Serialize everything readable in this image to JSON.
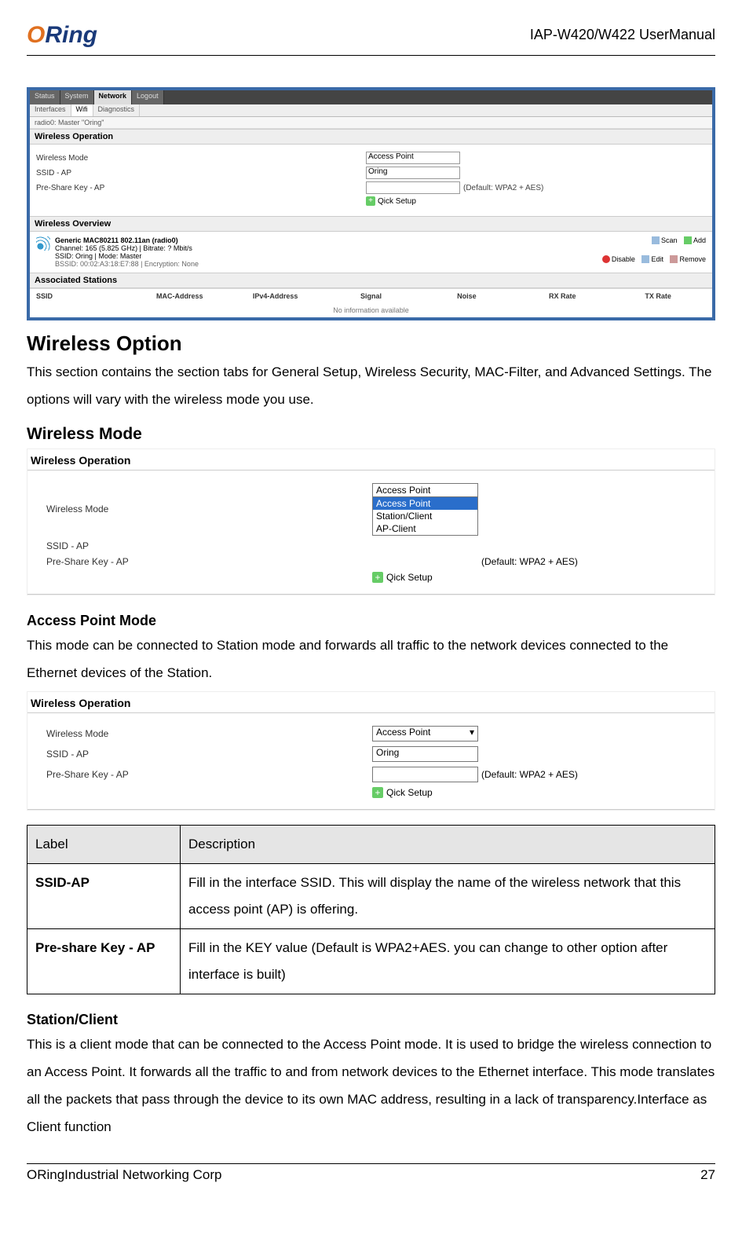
{
  "header": {
    "logo_1": "O",
    "logo_2": "Ring",
    "doc": "IAP-W420/W422  UserManual"
  },
  "ss1": {
    "tabs": [
      "Status",
      "System",
      "Network",
      "Logout"
    ],
    "subtabs": [
      "Interfaces",
      "Wifi",
      "Diagnostics"
    ],
    "crumb": "radio0: Master \"Oring\"",
    "sec_op": "Wireless Operation",
    "lbl_mode": "Wireless Mode",
    "sel_mode": "Access Point",
    "lbl_ssid": "SSID - AP",
    "val_ssid": "Oring",
    "lbl_psk": "Pre-Share Key - AP",
    "hint_psk": "(Default: WPA2 + AES)",
    "quick": "Qick Setup",
    "sec_ov": "Wireless Overview",
    "ov_l1": "Generic MAC80211 802.11an (radio0)",
    "ov_l2": "Channel: 165 (5.825 GHz) | Bitrate: ? Mbit/s",
    "ov_l3a": "SSID: Oring | Mode: Master",
    "ov_l3b": "BSSID: 00:02:A3:18:E7:88 | Encryption: None",
    "act_scan": "Scan",
    "act_add": "Add",
    "act_dis": "Disable",
    "act_edit": "Edit",
    "act_rem": "Remove",
    "sec_as": "Associated Stations",
    "cols": [
      "SSID",
      "MAC-Address",
      "IPv4-Address",
      "Signal",
      "Noise",
      "RX Rate",
      "TX Rate"
    ],
    "no_info": "No information available"
  },
  "h_wireless_option": "Wireless Option",
  "p_wireless_option": "This section contains the section tabs for General Setup, Wireless Security, MAC-Filter, and Advanced Settings. The options will vary with the wireless mode you use.",
  "h_wireless_mode": "Wireless Mode",
  "ss2": {
    "title": "Wireless Operation",
    "lbl_mode": "Wireless Mode",
    "sel_mode": "Access Point",
    "opts": [
      "Access Point",
      "Station/Client",
      "AP-Client"
    ],
    "lbl_ssid": "SSID - AP",
    "lbl_psk": "Pre-Share Key - AP",
    "hint_psk": "(Default: WPA2 + AES)",
    "quick": "Qick Setup"
  },
  "h_ap": "Access Point Mode",
  "p_ap": "This mode can be connected to Station mode and forwards all traffic to the network devices connected to the Ethernet devices of the Station.",
  "ss3": {
    "title": "Wireless Operation",
    "lbl_mode": "Wireless Mode",
    "sel_mode": "Access Point",
    "lbl_ssid": "SSID - AP",
    "val_ssid": "Oring",
    "lbl_psk": "Pre-Share Key - AP",
    "hint_psk": "(Default: WPA2 + AES)",
    "quick": "Qick Setup"
  },
  "table": {
    "h1": "Label",
    "h2": "Description",
    "r1l": "SSID-AP",
    "r1d": "Fill in the interface SSID. This will display the name of the wireless network that this access point (AP) is offering.",
    "r2l": "Pre-share Key - AP",
    "r2d": "Fill in the KEY value (Default is WPA2+AES. you can change to other option after interface is built)"
  },
  "h_station": "Station/Client",
  "p_station": "This is a client mode that can be connected to the Access Point mode. It is used to bridge the wireless connection to an Access Point. It forwards all the traffic to and from network devices to the Ethernet interface. This mode translates all the packets that pass through the device to its own MAC address, resulting in a lack of transparency.Interface as Client function",
  "footer": {
    "left": "ORingIndustrial Networking Corp",
    "right": "27"
  }
}
